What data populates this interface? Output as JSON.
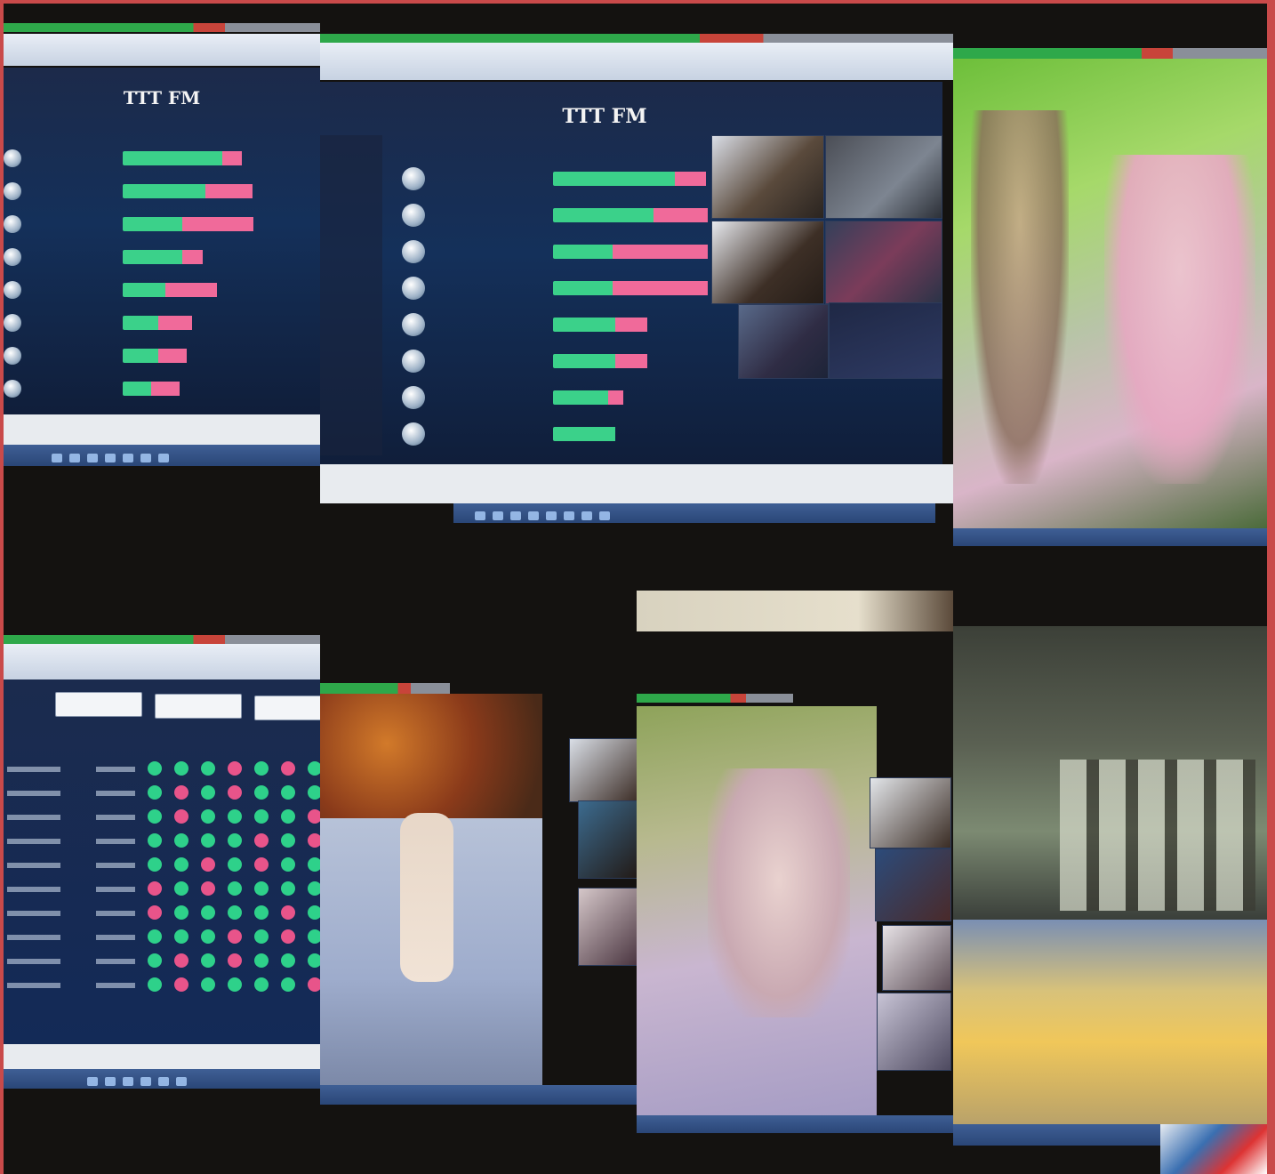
{
  "tiles": {
    "top_left": {
      "app_title": "TTT FM",
      "rows": [
        {
          "label": "",
          "green": 0.7,
          "pink": 0.14
        },
        {
          "label": "",
          "green": 0.58,
          "pink": 0.33
        },
        {
          "label": "",
          "green": 0.42,
          "pink": 0.5
        },
        {
          "label": "",
          "green": 0.42,
          "pink": 0.14
        },
        {
          "label": "",
          "green": 0.3,
          "pink": 0.36
        },
        {
          "label": "",
          "green": 0.25,
          "pink": 0.24
        },
        {
          "label": "",
          "green": 0.25,
          "pink": 0.2
        },
        {
          "label": "",
          "green": 0.2,
          "pink": 0.2
        }
      ]
    },
    "top_center": {
      "app_title": "TTT FM",
      "rows": [
        {
          "label": "",
          "green": 0.78,
          "pink": 0.2
        },
        {
          "label": "",
          "green": 0.64,
          "pink": 0.35
        },
        {
          "label": "",
          "green": 0.38,
          "pink": 0.61
        },
        {
          "label": "",
          "green": 0.38,
          "pink": 0.61
        },
        {
          "label": "",
          "green": 0.4,
          "pink": 0.2
        },
        {
          "label": "",
          "green": 0.4,
          "pink": 0.2
        },
        {
          "label": "",
          "green": 0.35,
          "pink": 0.1
        },
        {
          "label": "",
          "green": 0.4,
          "pink": 0.0
        }
      ],
      "video_caption": ""
    },
    "bottom_left": {
      "tabs": [
        "",
        "",
        ""
      ],
      "grid_rows": 10,
      "grid_cols": 7
    }
  },
  "colors": {
    "frame": "#c94a4a",
    "bar_green": "#3bd18a",
    "bar_pink": "#f06a9a",
    "app_bg": "#14305a",
    "taskbar": "#2a4677"
  },
  "icons": {
    "avatar": "avatar-icon",
    "taskbar": "taskbar-icon"
  }
}
